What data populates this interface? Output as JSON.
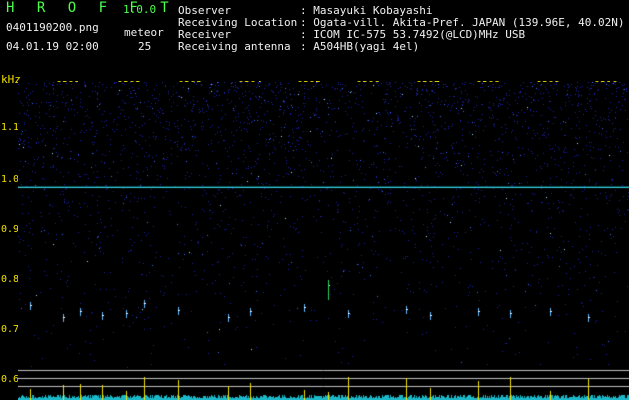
{
  "header": {
    "app_title": "H R O F F T",
    "app_version": "1.0.0",
    "file_name": "0401190200.png",
    "meteor_label": "meteor",
    "meteor_count": "25",
    "datetime": "04.01.19 02:00"
  },
  "info": [
    {
      "key": "Observer",
      "value": ": Masayuki Kobayashi"
    },
    {
      "key": "Receiving Location",
      "value": ": Ogata-vill. Akita-Pref. JAPAN (139.96E, 40.02N)"
    },
    {
      "key": "Receiver",
      "value": ": ICOM IC-575 53.7492(@LCD)MHz USB"
    },
    {
      "key": "Receiving antenna",
      "value": ": A504HB(yagi 4el)"
    }
  ],
  "axis": {
    "y_unit": "kHz",
    "y_ticks": [
      "1.1",
      "1.0",
      "0.9",
      "0.8",
      "0.7",
      "0.6"
    ],
    "x_ticks": [
      "0201",
      "0202",
      "0203",
      "0204",
      "0205",
      "0206",
      "0207",
      "0208",
      "0209",
      "0210"
    ]
  },
  "colors": {
    "background": "#000000",
    "noise": "#1c1ca0",
    "carrier": "#30d0e0",
    "axis_text": "#f0e000",
    "header_green": "#4cff4c"
  }
}
